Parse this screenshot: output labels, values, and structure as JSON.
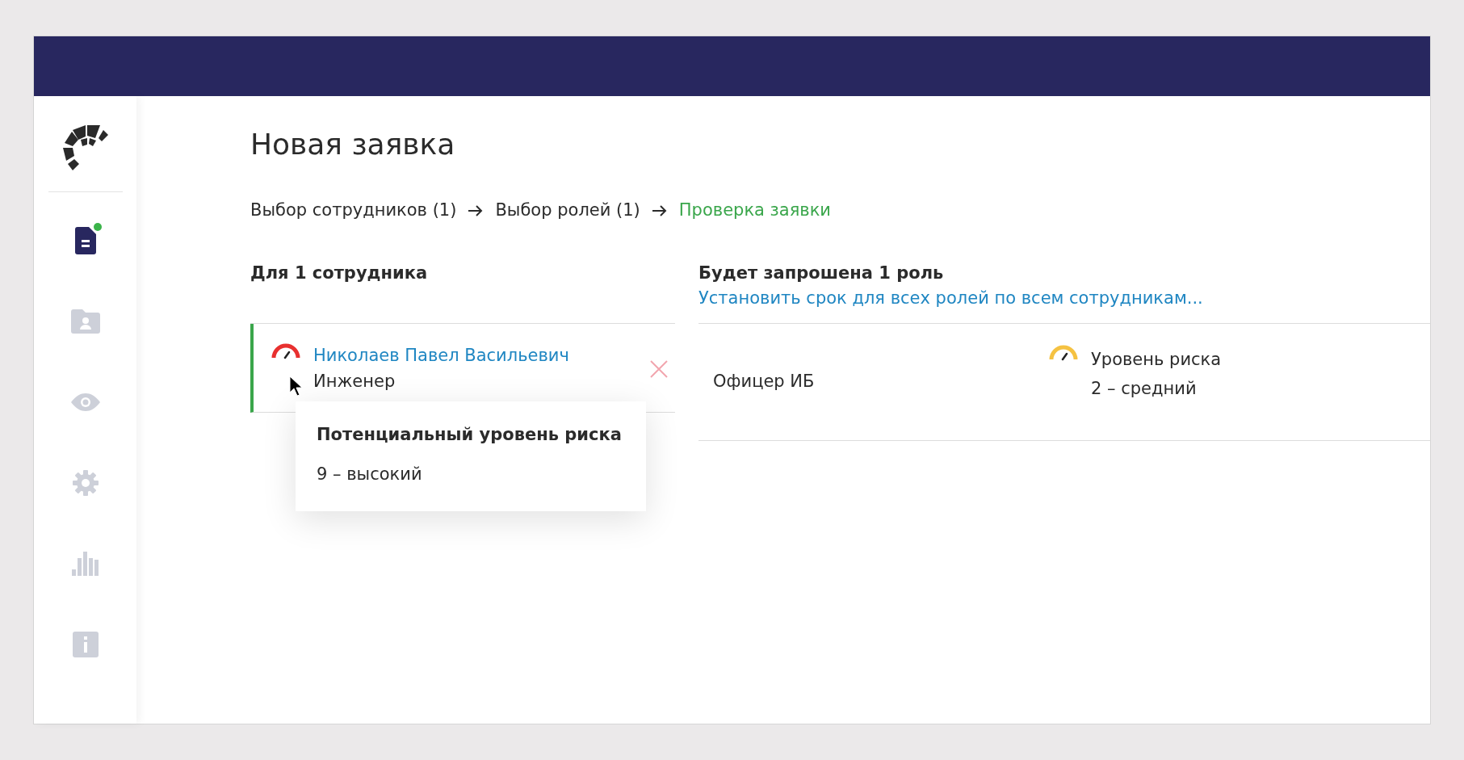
{
  "sidebar": {
    "items": [
      {
        "kind": "document",
        "selected": true,
        "notification": true
      },
      {
        "kind": "folder-person",
        "selected": false,
        "notification": false
      },
      {
        "kind": "eye",
        "selected": false,
        "notification": false
      },
      {
        "kind": "gear",
        "selected": false,
        "notification": false
      },
      {
        "kind": "bars",
        "selected": false,
        "notification": false
      },
      {
        "kind": "info",
        "selected": false,
        "notification": false
      }
    ]
  },
  "title": "Новая заявка",
  "steps": [
    {
      "label": "Выбор сотрудников (1)",
      "selected": false
    },
    {
      "label": "Выбор ролей (1)",
      "selected": false
    },
    {
      "label": "Проверка заявки",
      "selected": true
    }
  ],
  "employees": {
    "heading": "Для 1 сотрудника",
    "items": [
      {
        "name": "Николаев Павел Васильевич",
        "position": "Инженер",
        "color": "#e8302f",
        "tooltip": {
          "title": "Потенциальный уровень риска",
          "value": "9 – высокий"
        }
      }
    ]
  },
  "roles": {
    "heading": "Будет запрошена 1 роль",
    "link": "Установить срок для всех ролей по всем сотрудникам...",
    "items": [
      {
        "name": "Офицер ИБ",
        "risk_label": "Уровень риска",
        "risk_value": "2 – средний",
        "color": "#f5c242"
      }
    ]
  }
}
